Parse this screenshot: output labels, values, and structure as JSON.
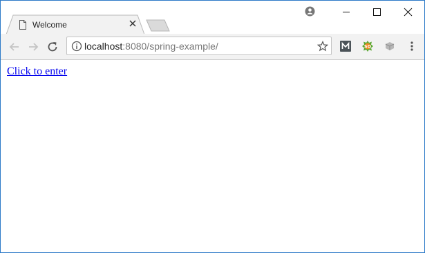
{
  "tab": {
    "title": "Welcome",
    "icon": "document-icon",
    "close_icon": "close-icon"
  },
  "window_controls": {
    "minimize_icon": "minimize-icon",
    "maximize_icon": "maximize-icon",
    "close_icon": "close-icon"
  },
  "profile": {
    "icon": "profile-icon"
  },
  "toolbar": {
    "back_icon": "back-arrow-icon",
    "forward_icon": "forward-arrow-icon",
    "reload_icon": "reload-icon",
    "address": {
      "host": "localhost",
      "rest": ":8080/spring-example/",
      "info_icon": "info-icon",
      "bookmark_icon": "star-icon"
    },
    "extensions": [
      "m-extension-icon",
      "sq-extension-icon",
      "gray-extension-icon"
    ],
    "menu_icon": "more-vertical-icon"
  },
  "page": {
    "link_text": "Click to enter"
  },
  "colors": {
    "window_border": "#2b79c8",
    "toolbar_bg": "#f2f2f2",
    "link": "#0000ee"
  }
}
